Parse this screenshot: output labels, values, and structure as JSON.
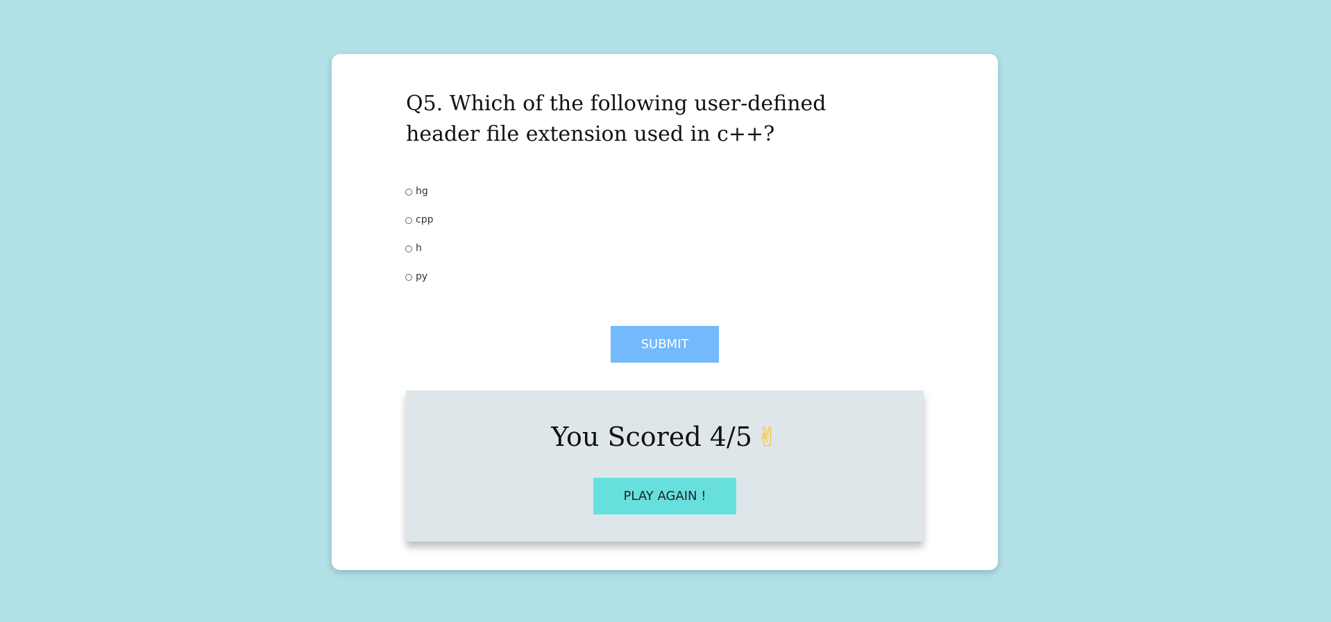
{
  "question": {
    "text": "Q5. Which of the following user-defined header file extension used in c++?"
  },
  "options": [
    {
      "label": "hg",
      "selected": false
    },
    {
      "label": "cpp",
      "selected": false
    },
    {
      "label": "h",
      "selected": false
    },
    {
      "label": "py",
      "selected": false
    }
  ],
  "submit": {
    "label": "SUBMIT"
  },
  "result": {
    "score_text": "You Scored 4/5",
    "emoji": "✌",
    "play_again_label": "PLAY AGAIN !"
  },
  "colors": {
    "background": "#b1e0e7",
    "submit_button": "#74b9fc",
    "result_panel": "#dfe6e9",
    "play_again_button": "#67e0dd"
  }
}
